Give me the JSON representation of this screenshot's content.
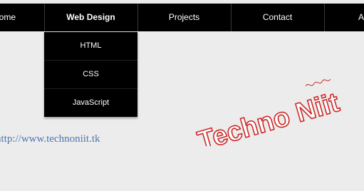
{
  "nav": {
    "items": [
      {
        "label": "Home"
      },
      {
        "label": "Web Design"
      },
      {
        "label": "Projects"
      },
      {
        "label": "Contact"
      },
      {
        "label": "About"
      }
    ]
  },
  "dropdown": {
    "items": [
      {
        "label": "HTML"
      },
      {
        "label": "CSS"
      },
      {
        "label": "JavaScript"
      }
    ]
  },
  "link": {
    "url": "http://www.technoniit.tk"
  },
  "watermark": {
    "text": "Techno Niit",
    "color": "#cc2a2a"
  },
  "colors": {
    "nav_bg": "#000000",
    "page_bg": "#ececec",
    "link": "#4b77b5"
  }
}
